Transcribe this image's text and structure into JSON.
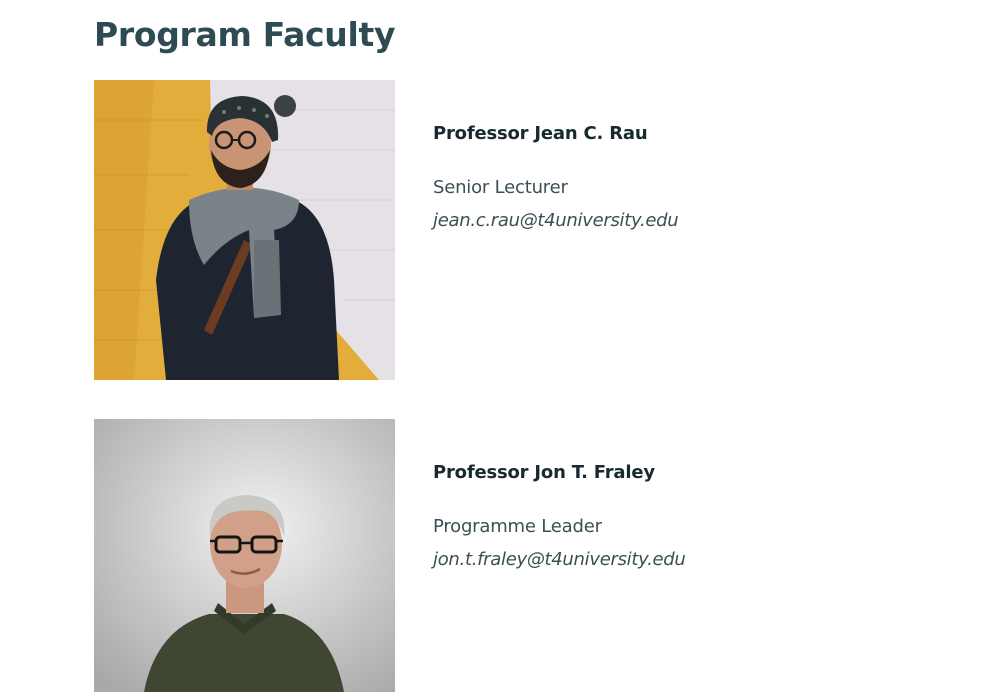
{
  "page": {
    "title": "Program Faculty"
  },
  "faculty": [
    {
      "name": "Professor Jean C. Rau",
      "role": "Senior Lecturer",
      "email": "jean.c.rau@t4university.edu",
      "photo_icon": "portrait-photo"
    },
    {
      "name": "Professor Jon T. Fraley",
      "role": "Programme Leader",
      "email": "jon.t.fraley@t4university.edu",
      "photo_icon": "portrait-photo"
    }
  ],
  "colors": {
    "title": "#2e4a52",
    "name": "#182a2f",
    "body_text": "#3c4f54",
    "background": "#ffffff"
  }
}
